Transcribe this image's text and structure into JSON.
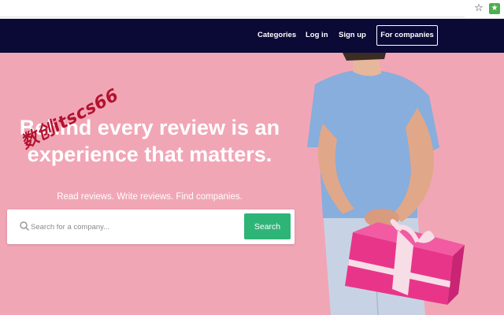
{
  "browser": {
    "icons": {
      "bookmark": "star-icon",
      "extension": "extension-icon"
    }
  },
  "nav": {
    "categories": "Categories",
    "login": "Log in",
    "signup": "Sign up",
    "for_companies": "For companies"
  },
  "hero": {
    "headline_line1": "Behind every review is an",
    "headline_line2": "experience that matters.",
    "subline": "Read reviews. Write reviews. Find companies.",
    "watermark": "数创itscs66"
  },
  "search": {
    "placeholder": "Search for a company...",
    "button_label": "Search",
    "icon": "search-icon"
  },
  "colors": {
    "navbar": "#0b0a37",
    "hero_bg": "#f1a6b6",
    "search_button": "#2fb478",
    "gift_box": "#e8358a"
  }
}
